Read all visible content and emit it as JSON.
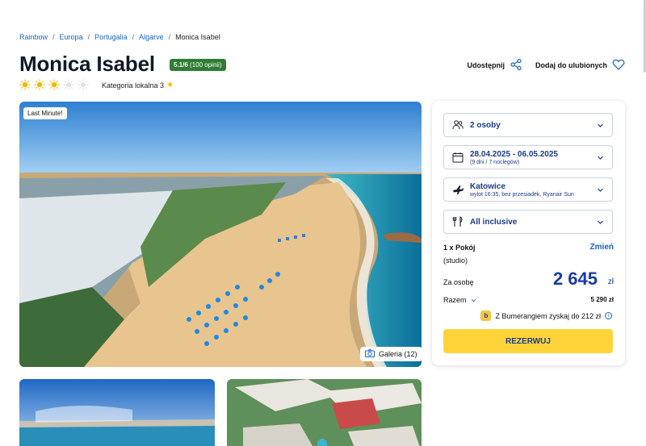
{
  "breadcrumb": {
    "items": [
      "Rainbow",
      "Europa",
      "Portugalia",
      "Algarve"
    ],
    "current": "Monica Isabel",
    "separator": "/"
  },
  "hotel": {
    "name": "Monica Isabel",
    "rating": "5.1/6",
    "reviews": "(100 opinii)",
    "sun_rating": 3,
    "sun_max": 5,
    "category_label": "Kategoria lokalna 3"
  },
  "actions": {
    "share": "Udostępnij",
    "favorite": "Dodaj do ulubionych"
  },
  "media": {
    "badge": "Last Minute!",
    "gallery": "Galeria (12)"
  },
  "booking": {
    "people": "2 osoby",
    "dates": "28.04.2025 - 06.05.2025",
    "dates_sub": "(9 dni / 7 noclegów)",
    "departure": "Katowice",
    "departure_sub": "wylot 16:35, bez przesiadek, Ryanair Sun",
    "board": "All inclusive",
    "room": "1 x Pokój",
    "room_change": "Zmień",
    "room_type": "(studio)",
    "per_person_label": "Za osobę",
    "price": "2 645",
    "currency": "zł",
    "total_label": "Razem",
    "total_value": "5 290 zł",
    "bumerang": "Z Bumerangiem zyskaj do 212 zł",
    "book_button": "REZERWUJ"
  },
  "colors": {
    "brand_blue": "#1a3aa8",
    "link_blue": "#1565c0",
    "rating_green": "#2e7d32",
    "cta_yellow": "#ffd43b",
    "sun_yellow": "#f5b800"
  }
}
